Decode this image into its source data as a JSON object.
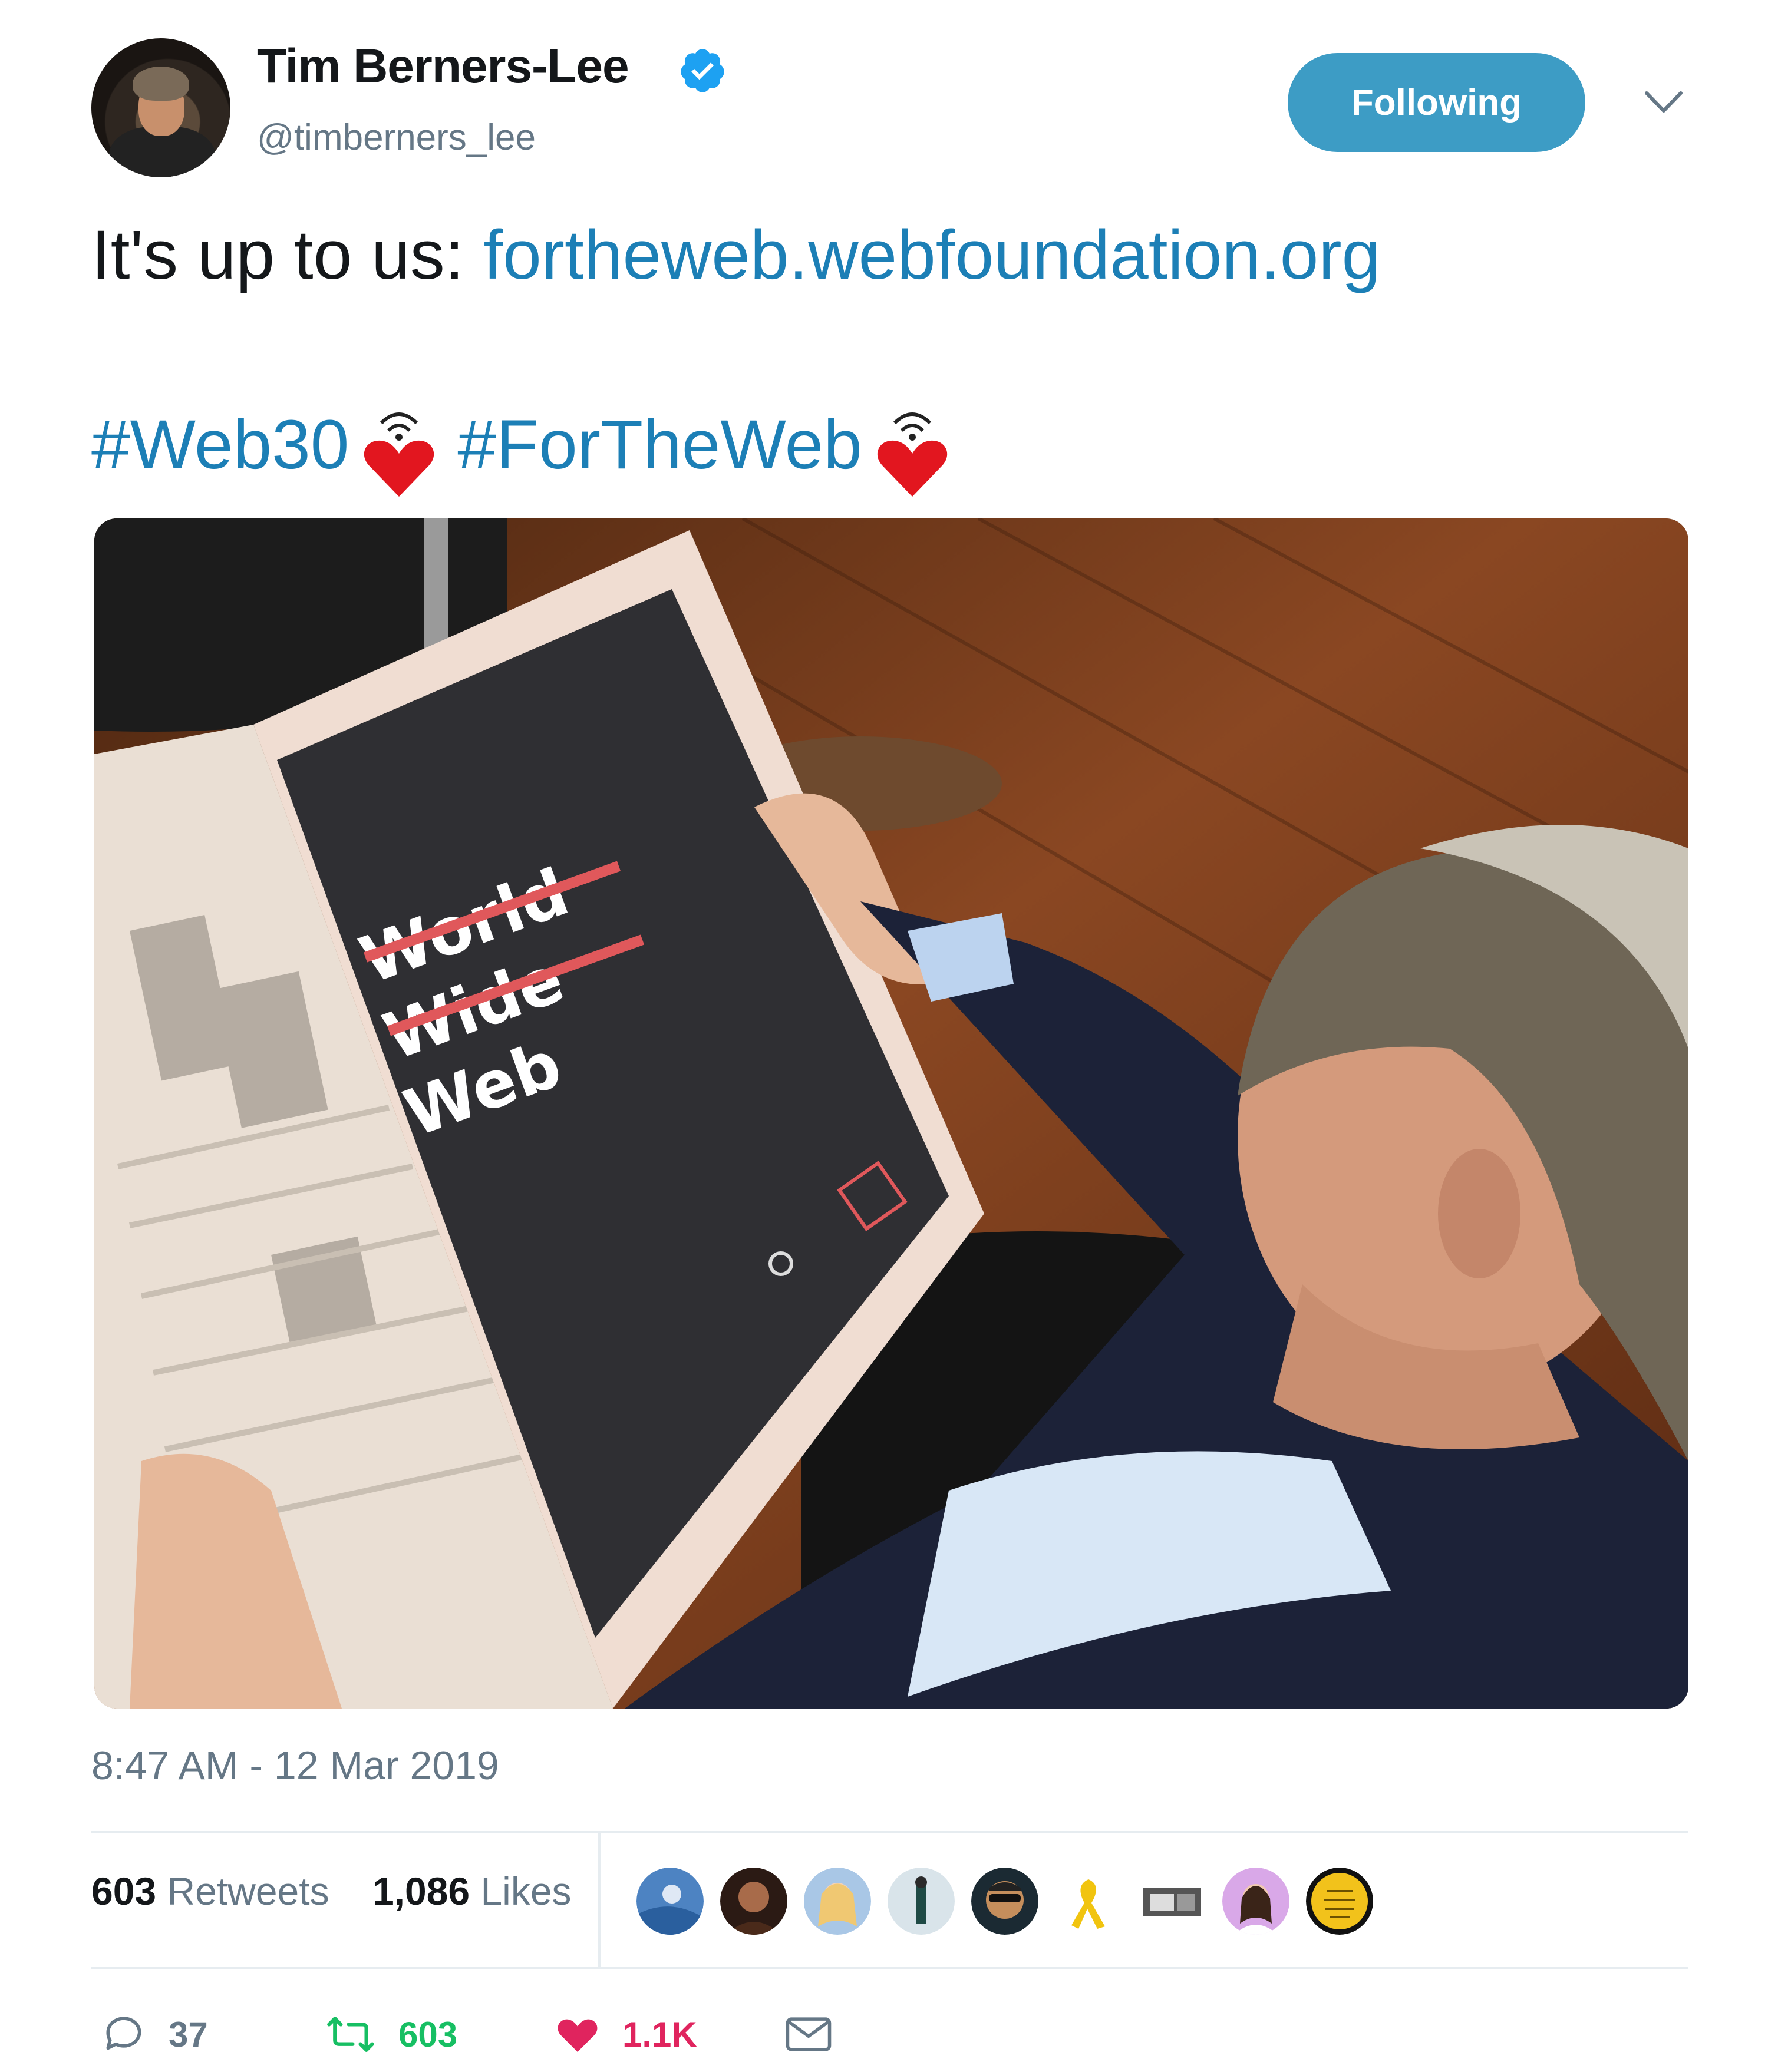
{
  "author": {
    "display_name": "Tim Berners-Lee",
    "handle": "@timberners_lee",
    "verified_icon": "verified-badge-icon",
    "follow_label": "Following",
    "menu_icon": "chevron-down-icon"
  },
  "tweet": {
    "prefix": "It's up to us:",
    "link": "fortheweb.webfoundation.org",
    "hashtag_1": "#Web30",
    "hashtag_2": "#ForTheWeb",
    "emoji": "heart-with-signal-emoji"
  },
  "photo": {
    "newspaper_text": [
      "World",
      "Wide",
      "Web"
    ]
  },
  "timestamp": "8:47 AM - 12 Mar 2019",
  "stats": {
    "retweets_count": "603",
    "retweets_label": "Retweets",
    "likes_count": "1,086",
    "likes_label": "Likes"
  },
  "likers_count_shown": 9,
  "actions": {
    "reply_count": "37",
    "retweet_count": "603",
    "like_count": "1.1K"
  },
  "colors": {
    "link": "#1c7fb6",
    "follow_button": "#3d9cc5",
    "retweet_green": "#17bf63",
    "like_red": "#e0245e",
    "muted": "#657786"
  }
}
